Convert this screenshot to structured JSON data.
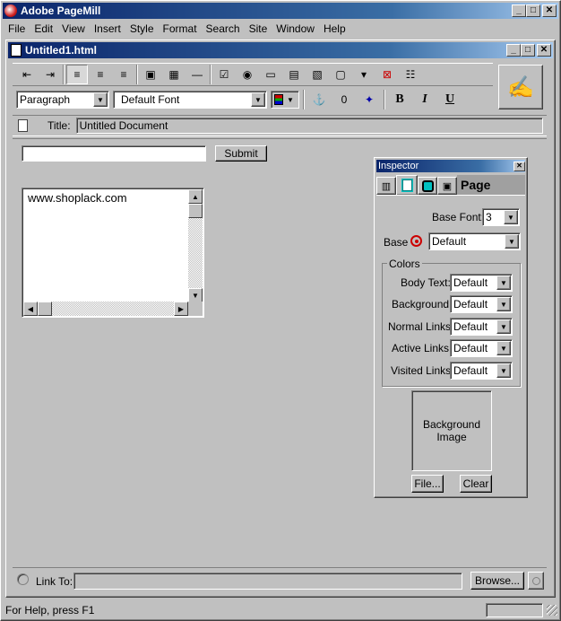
{
  "app": {
    "title": "Adobe PageMill"
  },
  "menu": [
    "File",
    "Edit",
    "View",
    "Insert",
    "Style",
    "Format",
    "Search",
    "Site",
    "Window",
    "Help"
  ],
  "doc": {
    "title": "Untitled1.html"
  },
  "toolbar": {
    "paragraph": "Paragraph",
    "font": "Default Font",
    "bold": "B",
    "italic": "I",
    "underline": "U"
  },
  "titlefield": {
    "label": "Title:",
    "value": "Untitled Document"
  },
  "form": {
    "submit": "Submit",
    "textarea_value": "www.shoplack.com"
  },
  "inspector": {
    "title": "Inspector",
    "tab_label": "Page",
    "base_font_label": "Base Font:",
    "base_font_value": "3",
    "base_label": "Base",
    "base_value": "Default",
    "colors_group": "Colors",
    "rows": [
      {
        "label": "Body Text:",
        "value": "Default"
      },
      {
        "label": "Background:",
        "value": "Default"
      },
      {
        "label": "Normal Links:",
        "value": "Default"
      },
      {
        "label": "Active Links:",
        "value": "Default"
      },
      {
        "label": "Visited Links:",
        "value": "Default"
      }
    ],
    "bg_image_line1": "Background",
    "bg_image_line2": "Image",
    "file_button": "File...",
    "clear_button": "Clear"
  },
  "linkbar": {
    "label": "Link To:",
    "browse": "Browse..."
  },
  "status": {
    "text": "For Help, press F1"
  },
  "colors": {
    "titlebar": "#0a246a",
    "face": "#c0c0c0",
    "inspector_accent": "#00c0c0"
  }
}
